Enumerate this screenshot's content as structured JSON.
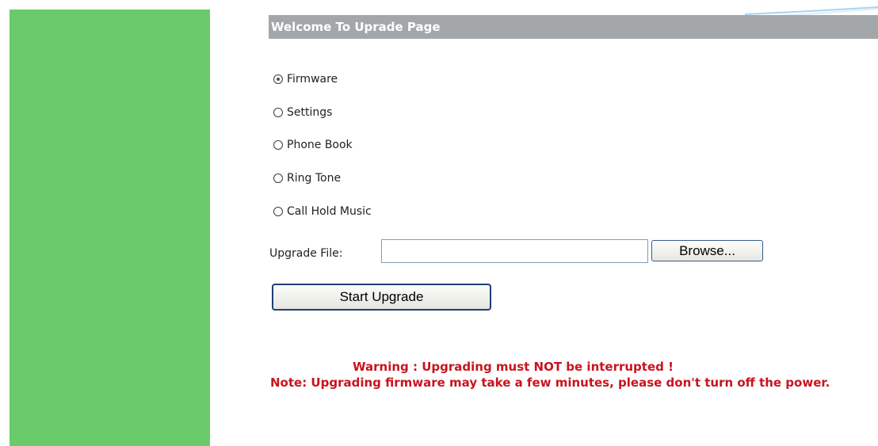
{
  "header": {
    "title": "Welcome To Uprade Page"
  },
  "upgrade_options": [
    {
      "label": "Firmware",
      "checked": true
    },
    {
      "label": "Settings",
      "checked": false
    },
    {
      "label": "Phone Book",
      "checked": false
    },
    {
      "label": "Ring Tone",
      "checked": false
    },
    {
      "label": "Call Hold Music",
      "checked": false
    }
  ],
  "file": {
    "label": "Upgrade File:",
    "value": "",
    "browse_label": "Browse..."
  },
  "actions": {
    "start_label": "Start Upgrade"
  },
  "messages": {
    "warning": "Warning : Upgrading must NOT be interrupted !",
    "note": "Note: Upgrading firmware may take a few minutes, please don't turn off the power."
  },
  "colors": {
    "sidebar": "#6acb6a",
    "title_bar": "#a3a7aa",
    "warning_text": "#c8141e"
  }
}
